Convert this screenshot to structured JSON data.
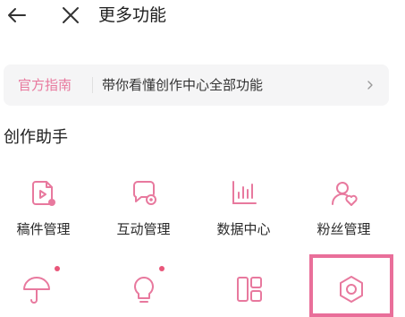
{
  "header": {
    "title": "更多功能",
    "back_icon": "arrow-left-icon",
    "close_icon": "close-x-icon"
  },
  "guide": {
    "tag": "官方指南",
    "text": "带你看懂创作中心全部功能",
    "chevron_icon": "chevron-right-icon"
  },
  "section": {
    "title": "创作助手"
  },
  "tools": [
    {
      "label": "稿件管理",
      "icon": "document-play-icon"
    },
    {
      "label": "互动管理",
      "icon": "chat-bubble-icon"
    },
    {
      "label": "数据中心",
      "icon": "bar-chart-icon"
    },
    {
      "label": "粉丝管理",
      "icon": "user-heart-icon"
    }
  ],
  "tools_row2": [
    {
      "icon": "umbrella-icon",
      "has_badge": true
    },
    {
      "icon": "lightbulb-icon",
      "has_badge": true
    },
    {
      "icon": "layout-grid-icon",
      "has_badge": false
    },
    {
      "icon": "settings-hexagon-icon",
      "has_badge": false,
      "highlighted": true
    }
  ],
  "colors": {
    "accent": "#e8799e",
    "badge": "#e9567a",
    "guide_bg": "#f5f5f6",
    "highlight": "#e96f9a"
  }
}
